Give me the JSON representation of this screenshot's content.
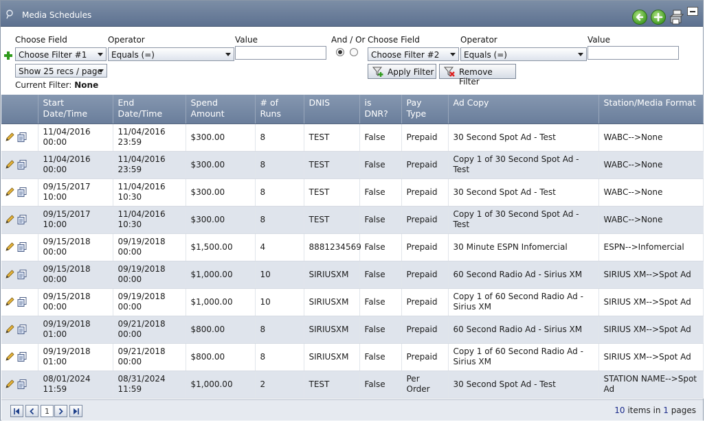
{
  "window": {
    "title": "Media Schedules"
  },
  "filter": {
    "choose_field_label": "Choose Field",
    "operator_label": "Operator",
    "value_label": "Value",
    "and_or_label": "And / Or",
    "filter1": {
      "field": "Choose Filter #1",
      "operator": "Equals (=)",
      "value": ""
    },
    "filter2": {
      "field": "Choose Filter #2",
      "operator": "Equals (=)",
      "value": ""
    },
    "page_size": "Show 25 recs / page",
    "apply_label": "Apply Filter",
    "remove_label": "Remove Filter",
    "current_filter_label": "Current Filter:",
    "current_filter_value": "None"
  },
  "grid": {
    "columns": [
      "",
      "Start Date/Time",
      "End Date/Time",
      "Spend Amount",
      "# of Runs",
      "DNIS",
      "is DNR?",
      "Pay Type",
      "Ad Copy",
      "Station/Media Format"
    ],
    "rows": [
      [
        "11/04/2016 00:00",
        "11/04/2016 23:59",
        "$300.00",
        "8",
        "TEST",
        "False",
        "Prepaid",
        "30 Second Spot Ad - Test",
        "WABC-->None"
      ],
      [
        "11/04/2016 00:00",
        "11/04/2016 23:59",
        "$300.00",
        "8",
        "TEST",
        "False",
        "Prepaid",
        "Copy 1 of 30 Second Spot Ad - Test",
        "WABC-->None"
      ],
      [
        "09/15/2017 10:00",
        "11/04/2016 10:30",
        "$300.00",
        "8",
        "TEST",
        "False",
        "Prepaid",
        "30 Second Spot Ad - Test",
        "WABC-->None"
      ],
      [
        "09/15/2017 10:00",
        "11/04/2016 10:30",
        "$300.00",
        "8",
        "TEST",
        "False",
        "Prepaid",
        "Copy 1 of 30 Second Spot Ad - Test",
        "WABC-->None"
      ],
      [
        "09/15/2018 00:00",
        "09/19/2018 00:00",
        "$1,500.00",
        "4",
        "8881234569",
        "False",
        "Prepaid",
        "30 Minute ESPN Infomercial",
        "ESPN-->Infomercial"
      ],
      [
        "09/15/2018 00:00",
        "09/19/2018 00:00",
        "$1,000.00",
        "10",
        "SIRIUSXM",
        "False",
        "Prepaid",
        "60 Second Radio Ad - Sirius XM",
        "SIRIUS XM-->Spot Ad"
      ],
      [
        "09/15/2018 00:00",
        "09/19/2018 00:00",
        "$1,000.00",
        "10",
        "SIRIUSXM",
        "False",
        "Prepaid",
        "Copy 1 of 60 Second Radio Ad - Sirius XM",
        "SIRIUS XM-->Spot Ad"
      ],
      [
        "09/19/2018 01:00",
        "09/21/2018 00:00",
        "$800.00",
        "8",
        "SIRIUSXM",
        "False",
        "Prepaid",
        "60 Second Radio Ad - Sirius XM",
        "SIRIUS XM-->Spot Ad"
      ],
      [
        "09/19/2018 01:00",
        "09/21/2018 00:00",
        "$800.00",
        "8",
        "SIRIUSXM",
        "False",
        "Prepaid",
        "Copy 1 of 60 Second Radio Ad - Sirius XM",
        "SIRIUS XM-->Spot Ad"
      ],
      [
        "08/01/2024 11:59",
        "08/31/2024 11:59",
        "$1,000.00",
        "2",
        "TEST",
        "False",
        "Per Order",
        "30 Second Spot Ad - Test",
        "STATION NAME-->Spot Ad"
      ]
    ]
  },
  "pager": {
    "current_page": "1",
    "items_count": "10",
    "items_label": "items in",
    "pages_count": "1",
    "pages_label": "pages"
  },
  "icons": {
    "edit": "pencil-icon",
    "copy": "copy-icon",
    "back": "back-arrow-icon",
    "add": "add-icon",
    "print": "print-icon",
    "minimize": "minimize-icon"
  },
  "colors": {
    "header": "#6a7e9b",
    "accent_green": "#49a02a",
    "row_alt": "#dfe4ec"
  }
}
